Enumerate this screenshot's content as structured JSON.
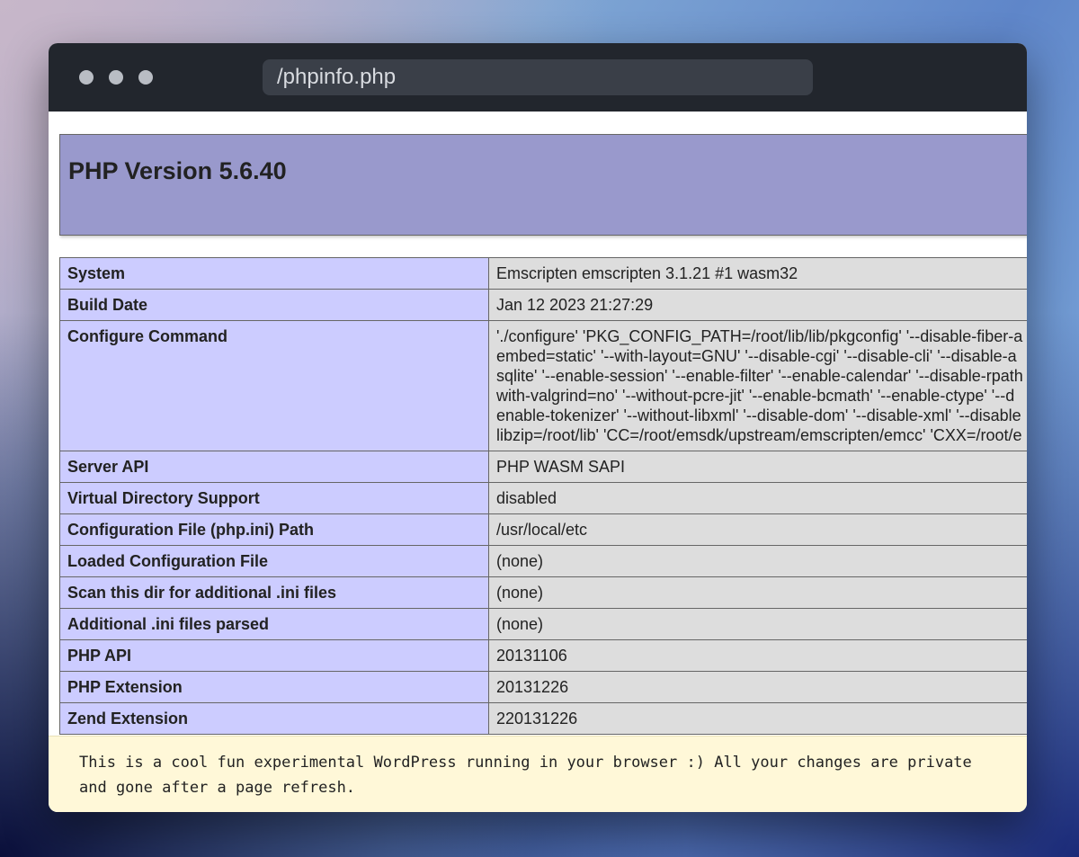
{
  "browser": {
    "url": "/phpinfo.php"
  },
  "page": {
    "title": "PHP Version 5.6.40",
    "rows": [
      {
        "label": "System",
        "value": "Emscripten emscripten 3.1.21 #1 wasm32"
      },
      {
        "label": "Build Date",
        "value": "Jan 12 2023 21:27:29"
      },
      {
        "label": "Configure Command",
        "lines": [
          "'./configure' 'PKG_CONFIG_PATH=/root/lib/lib/pkgconfig' '--disable-fiber-a",
          "embed=static' '--with-layout=GNU' '--disable-cgi' '--disable-cli' '--disable-a",
          "sqlite' '--enable-session' '--enable-filter' '--enable-calendar' '--disable-rpath",
          "with-valgrind=no' '--without-pcre-jit' '--enable-bcmath' '--enable-ctype' '--d",
          "enable-tokenizer' '--without-libxml' '--disable-dom' '--disable-xml' '--disable",
          "libzip=/root/lib' 'CC=/root/emsdk/upstream/emscripten/emcc' 'CXX=/root/e"
        ]
      },
      {
        "label": "Server API",
        "value": "PHP WASM SAPI"
      },
      {
        "label": "Virtual Directory Support",
        "value": "disabled"
      },
      {
        "label": "Configuration File (php.ini) Path",
        "value": "/usr/local/etc"
      },
      {
        "label": "Loaded Configuration File",
        "value": "(none)"
      },
      {
        "label": "Scan this dir for additional .ini files",
        "value": "(none)"
      },
      {
        "label": "Additional .ini files parsed",
        "value": "(none)"
      },
      {
        "label": "PHP API",
        "value": "20131106"
      },
      {
        "label": "PHP Extension",
        "value": "20131226"
      },
      {
        "label": "Zend Extension",
        "value": "220131226"
      }
    ]
  },
  "notice": {
    "text": "This is a cool fun experimental WordPress running in your browser :) All your changes are private and gone after a page refresh."
  },
  "colors": {
    "header_bg": "#9999cc",
    "label_bg": "#ccccff",
    "value_bg": "#dddddd",
    "notice_bg": "#fff8d8",
    "titlebar_bg": "#22262d"
  }
}
